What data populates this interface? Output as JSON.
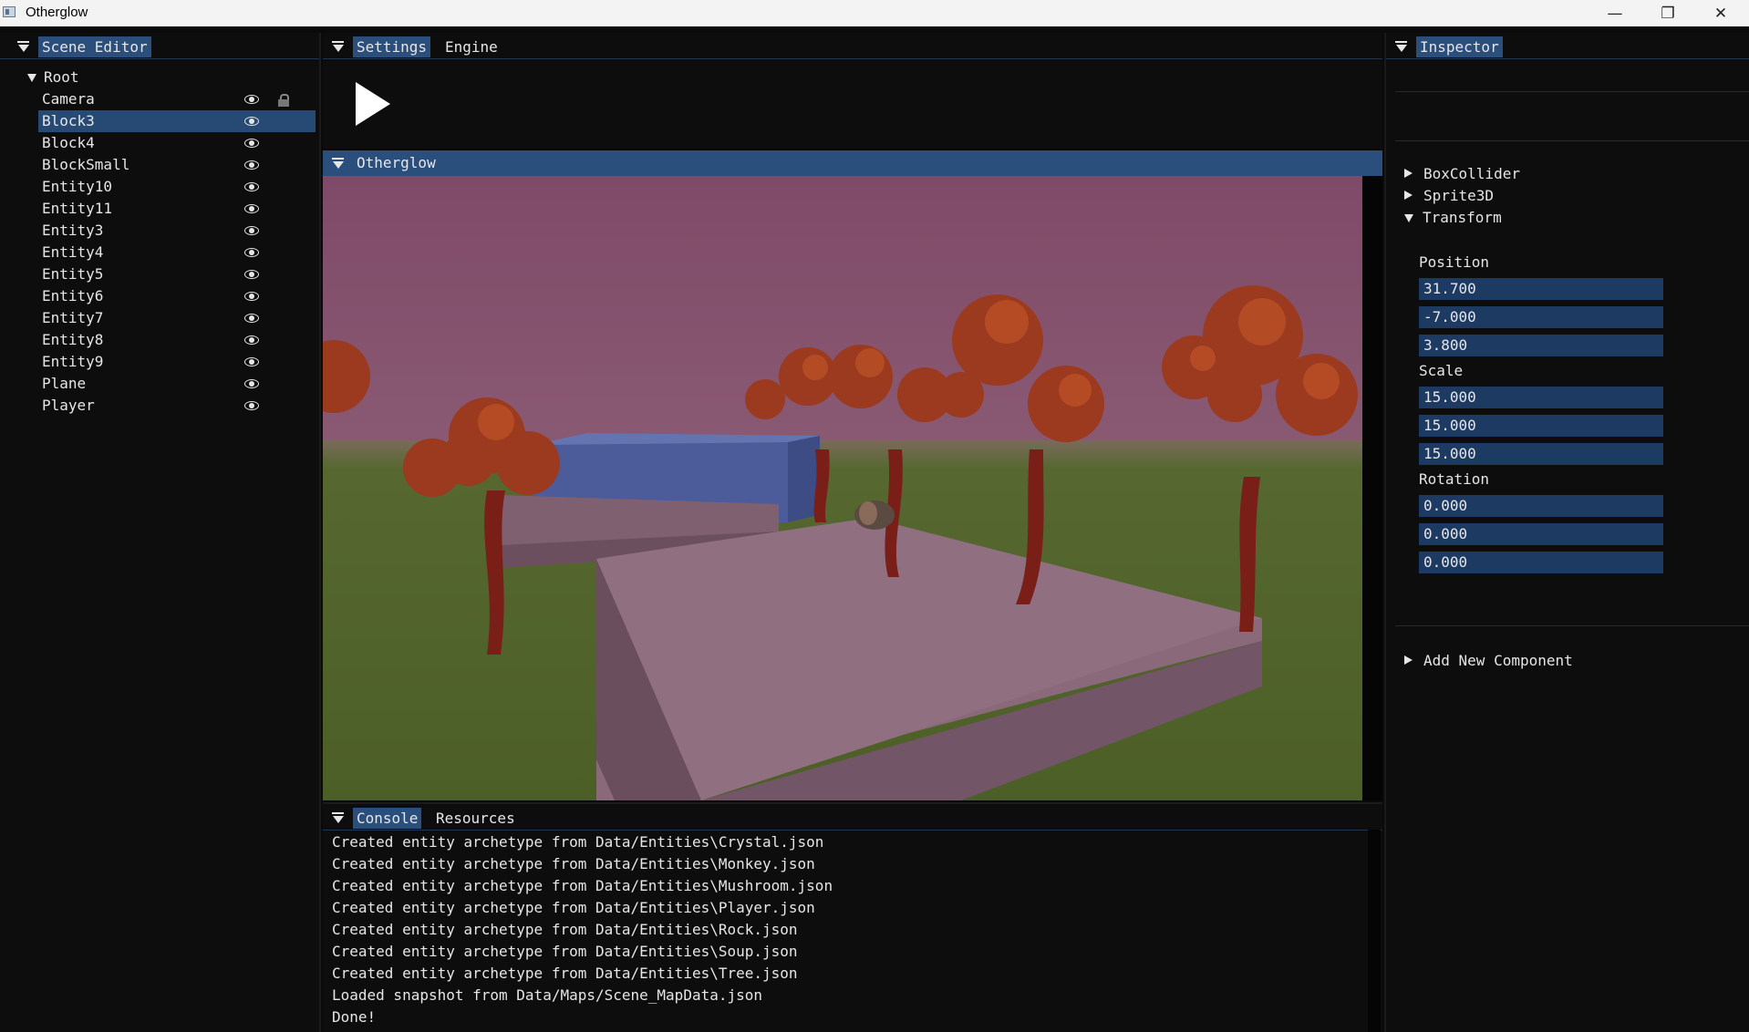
{
  "window": {
    "title": "Otherglow",
    "minimize_glyph": "—",
    "restore_glyph": "❐",
    "close_glyph": "✕"
  },
  "scene_editor": {
    "tab": "Scene Editor",
    "root_label": "Root",
    "items": [
      {
        "label": "Camera"
      },
      {
        "label": "Block3"
      },
      {
        "label": "Block4"
      },
      {
        "label": "BlockSmall"
      },
      {
        "label": "Entity10"
      },
      {
        "label": "Entity11"
      },
      {
        "label": "Entity3"
      },
      {
        "label": "Entity4"
      },
      {
        "label": "Entity5"
      },
      {
        "label": "Entity6"
      },
      {
        "label": "Entity7"
      },
      {
        "label": "Entity8"
      },
      {
        "label": "Entity9"
      },
      {
        "label": "Plane"
      },
      {
        "label": "Player"
      }
    ],
    "selected": "Block3"
  },
  "settings": {
    "tabs": [
      "Settings",
      "Engine"
    ]
  },
  "viewport": {
    "tab": "Otherglow"
  },
  "console": {
    "tabs": [
      "Console",
      "Resources"
    ],
    "lines": [
      "Created entity archetype from Data/Entities\\Crystal.json",
      "Created entity archetype from Data/Entities\\Monkey.json",
      "Created entity archetype from Data/Entities\\Mushroom.json",
      "Created entity archetype from Data/Entities\\Player.json",
      "Created entity archetype from Data/Entities\\Rock.json",
      "Created entity archetype from Data/Entities\\Soup.json",
      "Created entity archetype from Data/Entities\\Tree.json",
      "Loaded snapshot from Data/Maps/Scene_MapData.json",
      "Done!"
    ]
  },
  "inspector": {
    "tab": "Inspector",
    "components": [
      "BoxCollider",
      "Sprite3D",
      "Transform"
    ],
    "transform": {
      "position_label": "Position",
      "position": [
        "31.700",
        "-7.000",
        "3.800"
      ],
      "scale_label": "Scale",
      "scale": [
        "15.000",
        "15.000",
        "15.000"
      ],
      "rotation_label": "Rotation",
      "rotation": [
        "0.000",
        "0.000",
        "0.000"
      ]
    },
    "add_component": "Add New Component"
  },
  "colors": {
    "accent": "#2a4f7d",
    "field_bg": "#1d3a63",
    "sky": "#83506c",
    "grass": "#556b2f"
  }
}
